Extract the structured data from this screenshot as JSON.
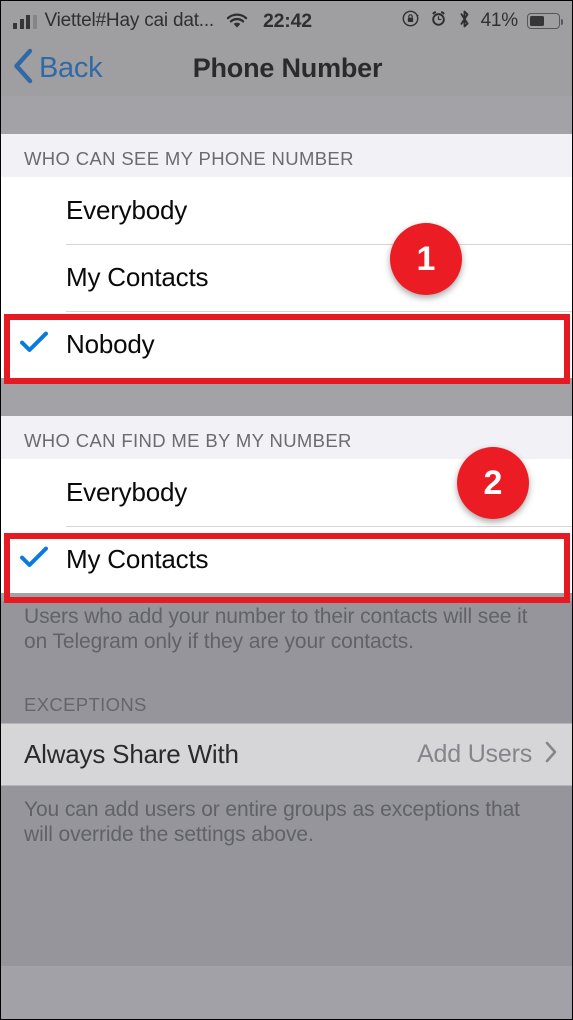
{
  "status_bar": {
    "signal_icon": "signal-bars-icon",
    "carrier": "Viettel#Hay cai dat...",
    "wifi_icon": "wifi-icon",
    "time": "22:42",
    "rotation_lock_icon": "rotation-lock-icon",
    "alarm_icon": "alarm-clock-icon",
    "bluetooth_icon": "bluetooth-icon",
    "battery_percent": "41%",
    "battery_icon": "battery-icon"
  },
  "nav_bar": {
    "back_label": "Back",
    "back_icon": "chevron-left-icon",
    "title": "Phone Number"
  },
  "sections": {
    "see_number": {
      "header": "WHO CAN SEE MY PHONE NUMBER",
      "options": [
        {
          "label": "Everybody",
          "selected": false
        },
        {
          "label": "My Contacts",
          "selected": false
        },
        {
          "label": "Nobody",
          "selected": true
        }
      ]
    },
    "find_me": {
      "header": "WHO CAN FIND ME BY MY NUMBER",
      "options": [
        {
          "label": "Everybody",
          "selected": false
        },
        {
          "label": "My Contacts",
          "selected": true
        }
      ],
      "footer": "Users who add your number to their contacts will see it on Telegram only if they are your contacts."
    },
    "exceptions": {
      "header": "EXCEPTIONS",
      "row_title": "Always Share With",
      "row_value": "Add Users",
      "row_chevron_icon": "chevron-right-icon",
      "footer": "You can add users or entire groups as exceptions that will override the settings above."
    }
  },
  "annotations": {
    "badge_one": "1",
    "badge_two": "2",
    "highlight_color": "#e51a22",
    "badge_color": "#ec1c24"
  },
  "colors": {
    "accent_blue": "#1464b4",
    "check_blue": "#0a7ae0",
    "section_header_bg": "#f1f1f6",
    "gap_band": "#a2a2a7",
    "row_bg": "#ffffff"
  }
}
